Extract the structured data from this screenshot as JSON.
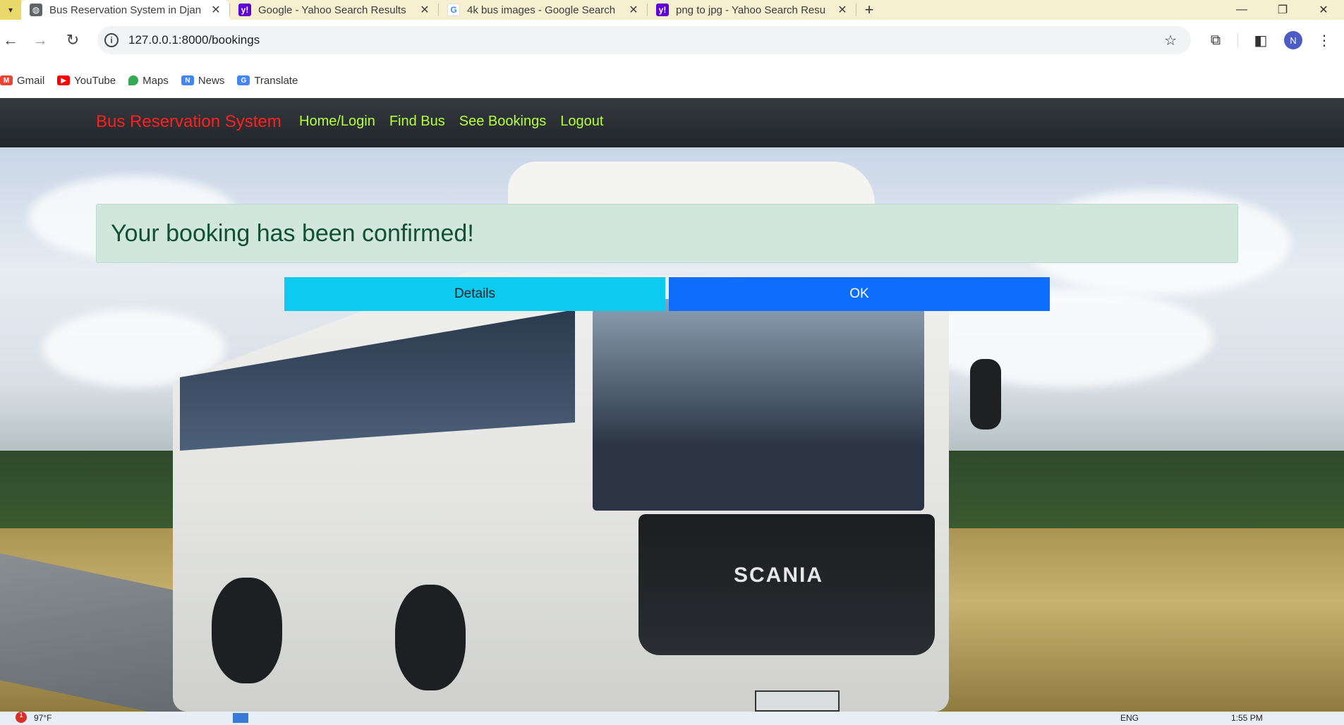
{
  "browser": {
    "tabs": [
      {
        "title": "Bus Reservation System in Djan",
        "active": true,
        "favicon": "globe-icon"
      },
      {
        "title": "Google - Yahoo Search Results",
        "active": false,
        "favicon": "yahoo-icon"
      },
      {
        "title": "4k bus images - Google Search",
        "active": false,
        "favicon": "google-icon"
      },
      {
        "title": "png to jpg - Yahoo Search Resu",
        "active": false,
        "favicon": "yahoo-icon"
      }
    ],
    "url": "127.0.0.1:8000/bookings",
    "profile_initial": "N",
    "bookmarks": [
      "Gmail",
      "YouTube",
      "Maps",
      "News",
      "Translate"
    ]
  },
  "navbar": {
    "brand": "Bus Reservation System",
    "links": [
      "Home/Login",
      "Find Bus",
      "See Bookings",
      "Logout"
    ]
  },
  "hero": {
    "bus_logo": "SCANIA"
  },
  "alert": {
    "message": "Your booking has been confirmed!"
  },
  "buttons": {
    "details": "Details",
    "ok": "OK"
  },
  "taskbar": {
    "temperature": "97°F",
    "language": "ENG",
    "time": "1:55 PM",
    "notification_count": "1"
  },
  "colors": {
    "brand": "#ff1f1f",
    "nav_link": "#b6ff3a",
    "alert_bg": "#d1e7dd",
    "alert_text": "#0f5132",
    "details_btn": "#0dcaf0",
    "ok_btn": "#0d6efd"
  }
}
